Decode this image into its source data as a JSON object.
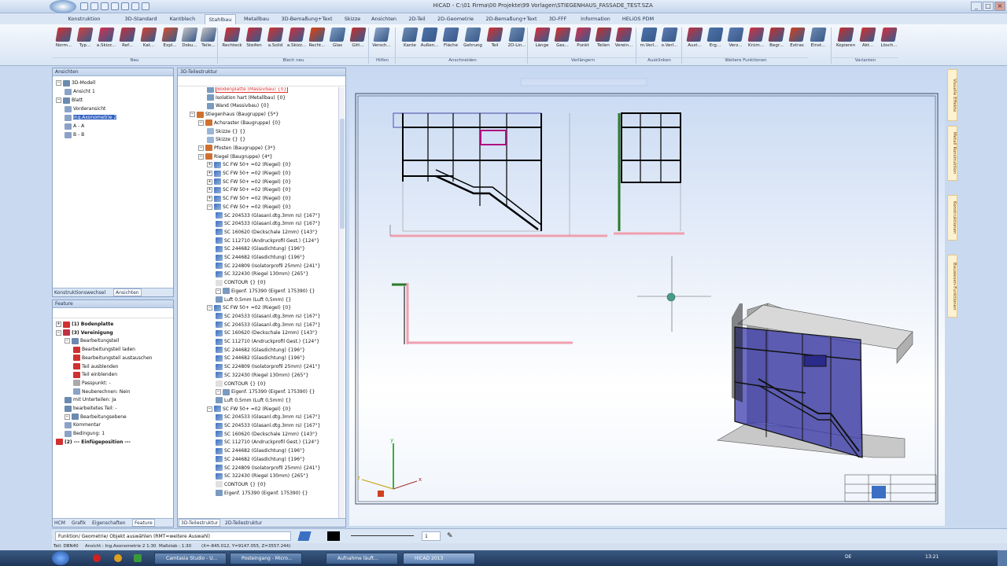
{
  "window": {
    "title": "HiCAD - C:\\01 Firma\\00 Projekte\\99 Vorlagen\\STIEGENHAUS_FASSADE_TEST.SZA"
  },
  "tabs": [
    "Konstruktion",
    "3D-Standard",
    "Kantblech",
    "Stahlbau",
    "Metallbau",
    "3D-Bemaßung+Text",
    "Skizze",
    "Ansichten",
    "2D-Teil",
    "2D-Geometrie",
    "2D-Bemaßung+Text",
    "3D-FFF",
    "Information",
    "HELiOS PDM"
  ],
  "ribbon": {
    "buttons": [
      "Norm...",
      "Typ...",
      "a.Skizz...",
      "Ref...",
      "Kat...",
      "Expl...",
      "Doku...",
      "Teile...",
      "Rechteck",
      "Steifen",
      "a.Solid",
      "a.Skizz...",
      "Recht...",
      "Glas",
      "Gitt...",
      "Versch...",
      "Kante",
      "Außen...",
      "Fläche",
      "Gehrung",
      "Teil",
      "2D-Lin...",
      "Länge",
      "Ges...",
      "Punkt",
      "Teilen",
      "Verein...",
      "m.Verl...",
      "o.Verl...",
      "Aust...",
      "Erg...",
      "Verz...",
      "Krüm...",
      "Begr...",
      "Extras",
      "Einst...",
      "Kopieren",
      "Akt...",
      "Lösch..."
    ],
    "groups": [
      "Neu",
      "Blech neu",
      "Hilfen",
      "Anschneiden",
      "Verlängern",
      "Ausklinken",
      "Weitere Funktionen",
      "Varianten"
    ]
  },
  "colors": {
    "accent": "#3a6fc4",
    "selected": "#2f5fc0",
    "highlight": "#e03030",
    "model": "#2a2aa0"
  },
  "ansichten": {
    "title": "Ansichten",
    "items": [
      "3D-Modell",
      "Ansicht 1",
      "Blatt",
      "Vorderansicht",
      "Ing.Axonometrie 2",
      "A - A",
      "B - B"
    ],
    "tabs": [
      "Konstruktionswechsel",
      "Ansichten"
    ]
  },
  "feature": {
    "title": "Feature",
    "items": [
      "(1) Bodenplatte",
      "(3) Vereinigung",
      "Bearbeitungsteil",
      "Bearbeitungsteil laden",
      "Bearbeitungsteil austauschen",
      "Teil ausblenden",
      "Teil einblenden",
      "Passpunkt: -",
      "Neuberechnen: Nein",
      "mit Unterteilen: Ja",
      "bearbeitetes Teil: -",
      "Bearbeitungsebene",
      "Kommentar",
      "Bedingung: 1",
      "(2) --- Einfügeposition ---"
    ],
    "tabs": [
      "HCM",
      "Grafik",
      "Eigenschaften",
      "Feature"
    ]
  },
  "tree": {
    "title": "3D-Teilestruktur",
    "items": [
      "Bodenplatte (Massivbau) {0}",
      "Isolation hart (Metallbau) {0}",
      "Wand (Massivbau) {0}",
      "Stiegenhaus (Baugruppe) {5*}",
      "Achsraster (Baugruppe) {0}",
      "Skizze {} {}",
      "Skizze {} {}",
      "Pfosten (Baugruppe) {3*}",
      "Riegel (Baugruppe) {4*}",
      "SC  FW 50+ =02 (Riegel) {0}",
      "SC  FW 50+ =02 (Riegel) {0}",
      "SC  FW 50+ =02 (Riegel) {0}",
      "SC  FW 50+ =02 (Riegel) {0}",
      "SC  FW 50+ =02 (Riegel) {0}",
      "SC  FW 50+ =02 (Riegel) {0}",
      "SC  204533 (Glasanl.dtg.3mm rs) {167°}",
      "SC  204533 (Glasanl.dtg.3mm rs) {167°}",
      "SC  160620 (Deckschale 12mm) {143°}",
      "SC  112710 (Andruckprofil Gest.) {124°}",
      "SC  244682 (Glasdichtung) {196°}",
      "SC  244682 (Glasdichtung) {196°}",
      "SC  224809 (Isolatorprofil 25mm) {241°}",
      "SC  322430 (Riegel 130mm) {265°}",
      "CONTOUR {} {0}",
      "Eigenf. 175390 (Eigenf. 175390) {}",
      "Luft 0,5mm (Luft 0,5mm) {}",
      "SC  FW 50+ =02 (Riegel) {0}",
      "SC  204533 (Glasanl.dtg.3mm rs) {167°}",
      "SC  204533 (Glasanl.dtg.3mm rs) {167°}",
      "SC  160620 (Deckschale 12mm) {143°}",
      "SC  112710 (Andruckprofil Gest.) {124°}",
      "SC  244682 (Glasdichtung) {196°}",
      "SC  244682 (Glasdichtung) {196°}",
      "SC  224809 (Isolatorprofil 25mm) {241°}",
      "SC  322430 (Riegel 130mm) {265°}",
      "CONTOUR {} {0}",
      "Eigenf. 175390 (Eigenf. 175390) {}",
      "Luft 0,5mm (Luft 0,5mm) {}",
      "SC  FW 50+ =02 (Riegel) {0}",
      "SC  204533 (Glasanl.dtg.3mm rs) {167°}",
      "SC  204533 (Glasanl.dtg.3mm rs) {167°}",
      "SC  160620 (Deckschale 12mm) {143°}",
      "SC  112710 (Andruckprofil Gest.) {124°}",
      "SC  244682 (Glasdichtung) {196°}",
      "SC  244682 (Glasdichtung) {196°}",
      "SC  224809 (Isolatorprofil 25mm) {241°}",
      "SC  322430 (Riegel 130mm) {265°}",
      "CONTOUR {} {0}",
      "Eigenf. 175390 (Eigenf. 175390) {}"
    ],
    "tabs": [
      "3D-Teilestruktur",
      "2D-Teilestruktur"
    ]
  },
  "right_tabs": [
    "Visuelle Effekte",
    "Metall Konstruktion",
    "Konstruktionen",
    "Bauwesen-Funktionen"
  ],
  "command": {
    "prompt": "Funktion/ Geometrie/ Objekt auswählen (RMT=weitere Auswahl)",
    "line_width": "1"
  },
  "status": {
    "teil": "Teil: DBN40",
    "ansicht": "Ansicht : Ing.Axonometrie 2  1:30",
    "massstab": "Maßstab : 1:30",
    "coords": "(X=-845.012, Y=9147.055, Z=3557.244)"
  },
  "taskbar": {
    "items": [
      "Camtasia Studio - U...",
      "Posteingang - Micro...",
      "Aufnahme läuft...",
      "HiCAD 2013"
    ],
    "lang": "DE",
    "time": "13:21"
  }
}
